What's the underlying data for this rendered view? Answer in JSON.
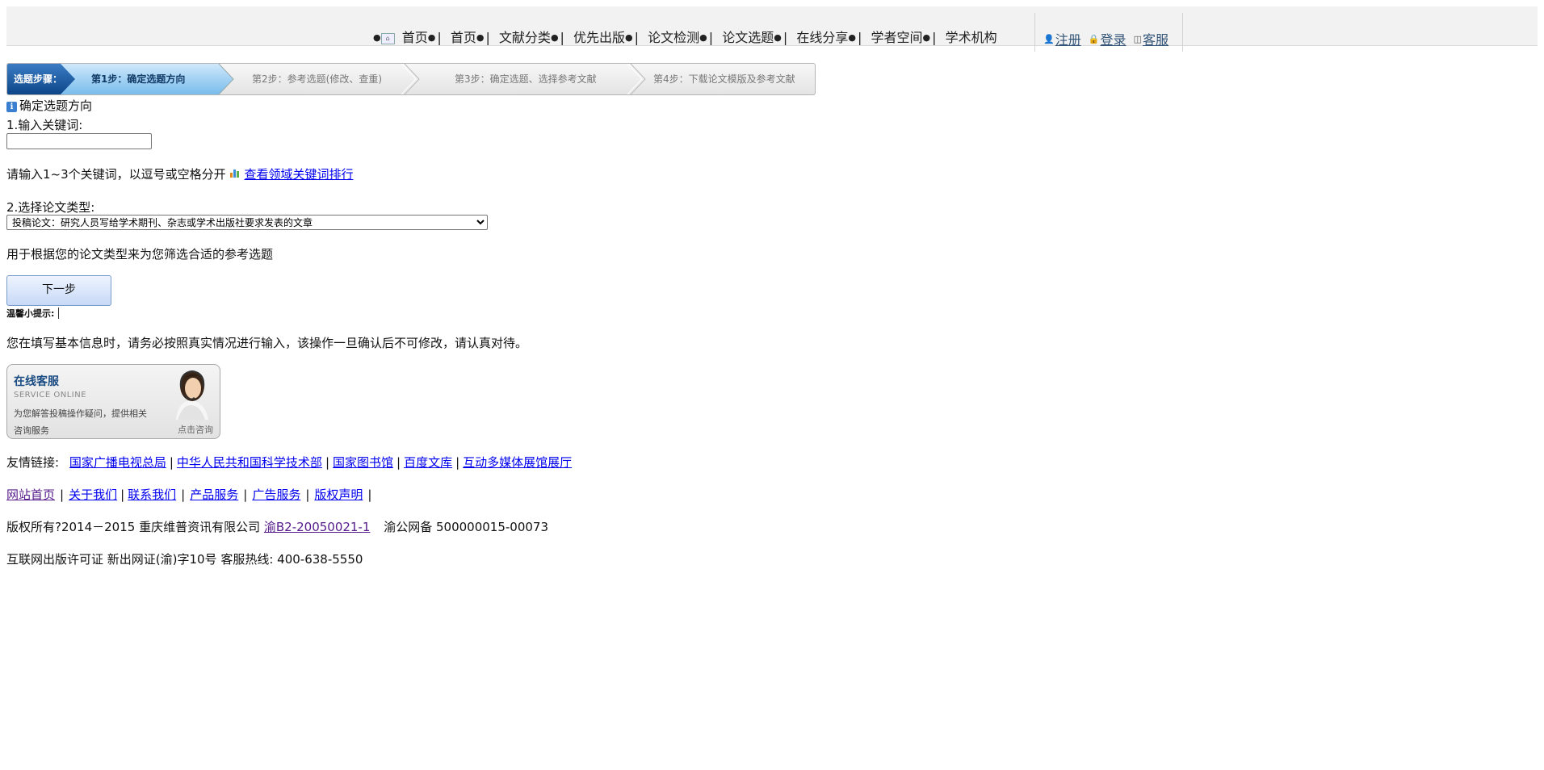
{
  "top_nav": {
    "items": [
      "首页",
      "首页",
      "文献分类",
      "优先出版",
      "论文检测",
      "论文选题",
      "在线分享",
      "学者空间",
      "学术机构"
    ]
  },
  "user_links": {
    "register": "注册",
    "login": "登录",
    "service": "客服"
  },
  "steps": {
    "lead": "选题步骤：",
    "step1": "第1步：确定选题方向",
    "step2": "第2步：参考选题(修改、查重)",
    "step3": "第3步：确定选题、选择参考文献",
    "step4": "第4步：下载论文模版及参考文献"
  },
  "form": {
    "heading": "确定选题方向",
    "keyword_label": "1.输入关键词:",
    "keyword_value": "",
    "keyword_hint": "请输入1~3个关键词，以逗号或空格分开",
    "rank_link": "查看领域关键词排行",
    "type_label": "2.选择论文类型:",
    "type_selected": "投稿论文：研究人员写给学术期刊、杂志或学术出版社要求发表的文章",
    "type_hint": "用于根据您的论文类型来为您筛选合适的参考选题",
    "next_button": "下一步",
    "tip_label": "温馨小提示:",
    "notice": "您在填写基本信息时，请务必按照真实情况进行输入，该操作一旦确认后不可修改，请认真对待。"
  },
  "service_box": {
    "title": "在线客服",
    "subtitle": "SERVICE ONLINE",
    "desc": "为您解答投稿操作疑问，提供相关咨询服务",
    "cta": "点击咨询"
  },
  "friend_links": {
    "label": "友情链接:",
    "items": [
      "国家广播电视总局",
      "中华人民共和国科学技术部",
      "国家图书馆",
      "百度文库",
      "互动多媒体展馆展厅"
    ]
  },
  "footer": {
    "links": [
      "网站首页",
      "关于我们",
      "联系我们",
      "产品服务",
      "广告服务",
      "版权声明"
    ],
    "copyright_prefix": "版权所有?2014－2015 重庆维普资讯有限公司",
    "icp_link": "渝B2-20050021-1",
    "record": "渝公网备 500000015-00073",
    "license": "互联网出版许可证 新出网证(渝)字10号 客服热线: 400-638-5550"
  },
  "colors": {
    "step_active": "#7fc1ef",
    "step_lead": "#1b5aa0",
    "link": "#0000ee"
  }
}
